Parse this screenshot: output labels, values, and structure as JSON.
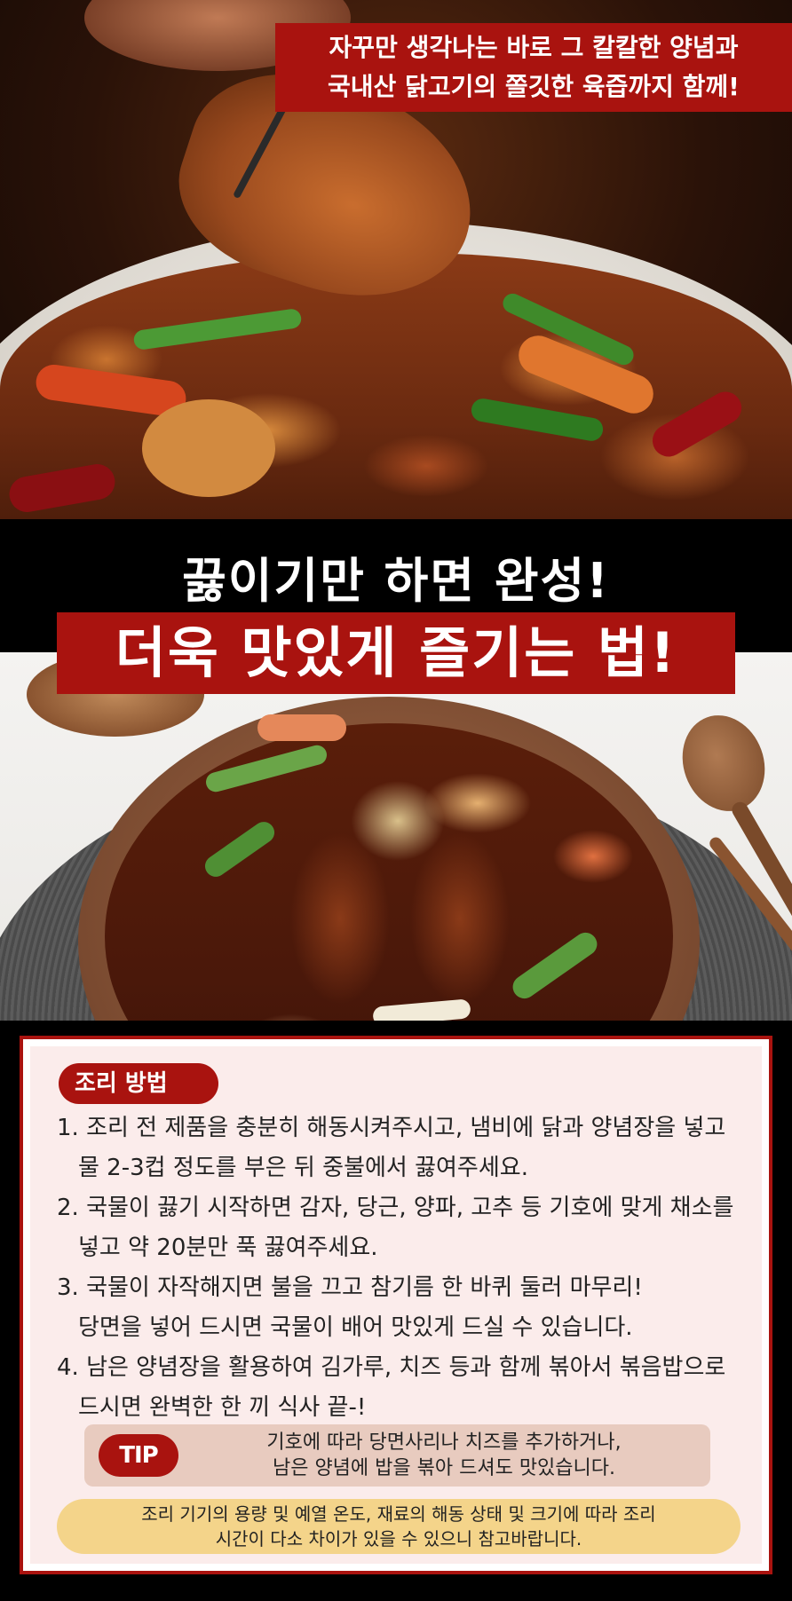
{
  "top_banner": {
    "line1": "자꾸만 생각나는 바로 그 칼칼한 양념과",
    "line2": "국내산 닭고기의 쫄깃한 육즙까지 함께!"
  },
  "headline": {
    "line1": "끓이기만 하면 완성!",
    "line2": "더욱 맛있게 즐기는 법!"
  },
  "recipe": {
    "title": "조리 방법",
    "steps": [
      {
        "line1": "1. 조리 전 제품을 충분히 해동시켜주시고, 냄비에 닭과 양념장을 넣고",
        "line2": "물 2-3컵 정도를 부은 뒤 중불에서 끓여주세요."
      },
      {
        "line1": "2. 국물이 끓기 시작하면 감자, 당근, 양파, 고추 등 기호에 맞게 채소를",
        "line2": "넣고 약 20분만 푹 끓여주세요."
      },
      {
        "line1": "3. 국물이 자작해지면 불을 끄고 참기름 한 바퀴 둘러 마무리!",
        "line2": "당면을 넣어 드시면 국물이 배어 맛있게 드실 수 있습니다."
      },
      {
        "line1": "4. 남은 양념장을 활용하여 김가루, 치즈 등과 함께 볶아서 볶음밥으로",
        "line2": "드시면 완벽한 한 끼 식사 끝-!"
      }
    ],
    "tip_label": "TIP",
    "tip_line1": "기호에 따라 당면사리나 치즈를 추가하거나,",
    "tip_line2": "남은 양념에 밥을 볶아 드셔도 맛있습니다.",
    "note_line1": "조리 기기의 용량 및 예열 온도, 재료의 해동 상태 및 크기에 따라 조리",
    "note_line2": "시간이 다소 차이가 있을 수 있으니 참고바랍니다."
  },
  "colors": {
    "brand_red": "#a9130f",
    "card_bg": "#fbeceb",
    "tip_bg": "#e8cbbf",
    "note_bg": "#f4d48a"
  }
}
